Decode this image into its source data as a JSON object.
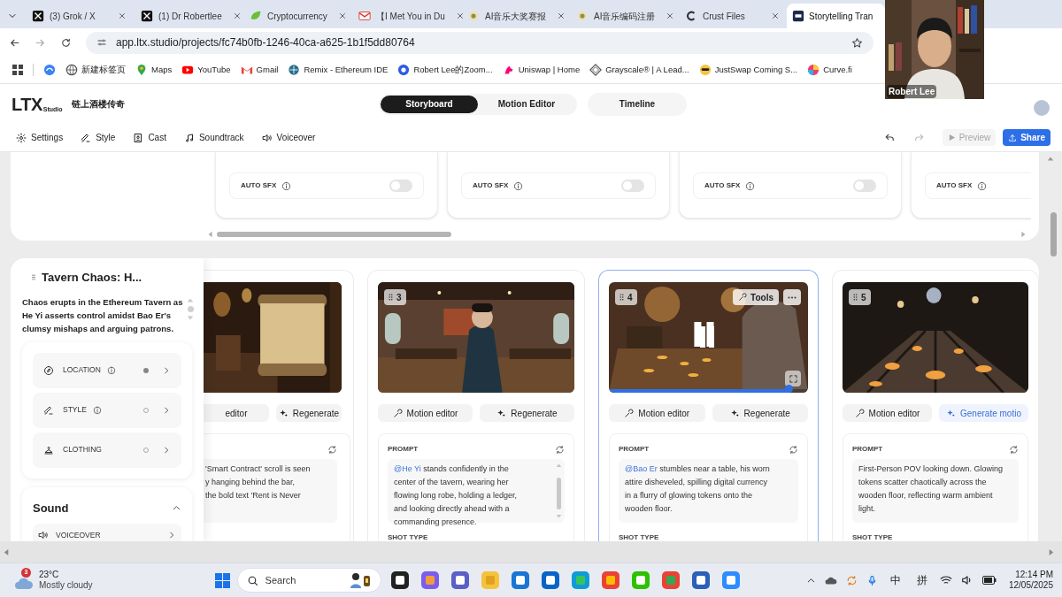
{
  "browser": {
    "tabs": [
      {
        "label": "(3) Grok / X",
        "selected": false,
        "closable": true
      },
      {
        "label": "(1) Dr Robertlee",
        "selected": false,
        "closable": true
      },
      {
        "label": "Cryptocurrency",
        "selected": false,
        "closable": true
      },
      {
        "label": "【I Met You in Du",
        "selected": false,
        "closable": true
      },
      {
        "label": "AI音乐大奖赛报",
        "selected": false,
        "closable": true
      },
      {
        "label": "AI音乐编码注册",
        "selected": false,
        "closable": true
      },
      {
        "label": "Crust Files",
        "selected": false,
        "closable": true
      },
      {
        "label": "Storytelling Tran",
        "selected": true,
        "closable": false
      }
    ],
    "url": "app.ltx.studio/projects/fc74b0fb-1246-40ca-a625-1b1f5dd80764",
    "bookmarks": [
      {
        "kind": "icon"
      },
      {
        "label": "新建标签页"
      },
      {
        "label": "Maps"
      },
      {
        "label": "YouTube"
      },
      {
        "label": "Gmail"
      },
      {
        "label": "Remix - Ethereum IDE"
      },
      {
        "label": "Robert Lee的Zoom..."
      },
      {
        "label": "Uniswap | Home"
      },
      {
        "label": "Grayscale® | A Lead..."
      },
      {
        "label": "JustSwap Coming S..."
      },
      {
        "label": "Curve.fi"
      }
    ]
  },
  "webcam": {
    "name": "Robert Lee"
  },
  "app": {
    "logo": "LTX",
    "logo_sub": "Studio",
    "project": "链上酒楼传奇",
    "modes": [
      {
        "label": "Storyboard",
        "selected": true
      },
      {
        "label": "Motion Editor",
        "selected": false
      }
    ],
    "timeline": "Timeline"
  },
  "toolbar": {
    "items": [
      "Settings",
      "Style",
      "Cast",
      "Soundtrack",
      "Voiceover"
    ],
    "preview": {
      "label": "Preview",
      "disabled": true
    },
    "share": "Share"
  },
  "sfx_cards": [
    {
      "label": "AUTO SFX",
      "on": false
    },
    {
      "label": "AUTO SFX",
      "on": false
    },
    {
      "label": "AUTO SFX",
      "on": false
    },
    {
      "label": "AUTO SFX"
    }
  ],
  "scene": {
    "title": "Tavern Chaos: H...",
    "description": "Chaos erupts in the Ethereum Tavern as He Yi asserts control amidst Bao Er's clumsy mishaps and arguing patrons.",
    "elements": [
      {
        "label": "LOCATION",
        "info": true,
        "filled": true
      },
      {
        "label": "STYLE",
        "info": true,
        "filled": false
      },
      {
        "label": "CLOTHING",
        "info": false,
        "filled": false
      }
    ],
    "sound": {
      "title": "Sound",
      "expanded": true,
      "items": [
        "VOICEOVER"
      ]
    }
  },
  "shots": [
    {
      "kind": "partial",
      "selected": false,
      "buttons": [
        {
          "label": "editor",
          "kind": "text"
        },
        {
          "label": "Regenerate",
          "kind": "regen"
        }
      ],
      "prompt": {
        "lines": [
          "'Smart Contract' scroll is seen",
          "y hanging behind the bar,",
          "the bold text 'Rent is Never"
        ]
      }
    },
    {
      "kind": "full",
      "number": "3",
      "selected": false,
      "buttons": [
        {
          "label": "Motion editor",
          "kind": "motion"
        },
        {
          "label": "Regenerate",
          "kind": "regen"
        }
      ],
      "prompt_label": "PROMPT",
      "prompt": {
        "mention": "@He Yi",
        "lines": [
          "stands confidently in the",
          "center of the tavern, wearing her",
          "flowing long robe, holding a ledger,",
          "and looking directly ahead with a",
          "commanding presence."
        ]
      },
      "scrollable": true,
      "shot_type": "SHOT TYPE"
    },
    {
      "kind": "full",
      "number": "4",
      "selected": true,
      "tools": "Tools",
      "progress": {
        "level": 0.9
      },
      "buttons": [
        {
          "label": "Motion editor",
          "kind": "motion"
        },
        {
          "label": "Regenerate",
          "kind": "regen"
        }
      ],
      "prompt_label": "PROMPT",
      "prompt": {
        "mention": "@Bao Er",
        "lines": [
          "stumbles near a table, his worn",
          "attire disheveled, spilling digital currency",
          "in a flurry of glowing tokens onto the",
          "wooden floor."
        ]
      },
      "scrollable": false,
      "shot_type": "SHOT TYPE"
    },
    {
      "kind": "full",
      "number": "5",
      "selected": false,
      "buttons": [
        {
          "label": "Motion editor",
          "kind": "motion"
        },
        {
          "label": "Generate motio",
          "kind": "generate"
        }
      ],
      "prompt_label": "PROMPT",
      "prompt": {
        "lines": [
          "First-Person POV looking down. Glowing",
          "tokens scatter chaotically across the",
          "wooden floor, reflecting warm ambient",
          "light."
        ]
      },
      "scrollable": false,
      "shot_type": "SHOT TYPE"
    }
  ],
  "taskbar": {
    "weather": {
      "badge": "3",
      "temp": "23°C",
      "desc": "Mostly cloudy"
    },
    "search": "Search",
    "ime": [
      "中",
      "拼"
    ],
    "time": "12:14 PM",
    "date": "12/05/2025"
  }
}
